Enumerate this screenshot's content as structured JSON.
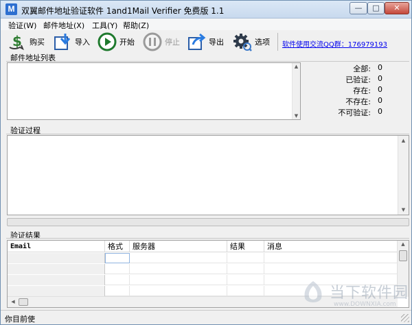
{
  "window": {
    "title": "双翼邮件地址验证软件 1and1Mail Verifier 免费版  1.1",
    "app_icon_letter": "M",
    "buttons": {
      "minimize": "—",
      "maximize": "□",
      "close": "✕"
    }
  },
  "menu": [
    {
      "label": "验证(W)"
    },
    {
      "label": "邮件地址(X)"
    },
    {
      "label": "工具(Y)"
    },
    {
      "label": "帮助(Z)"
    }
  ],
  "toolbar": {
    "buttons": [
      {
        "label": "购买",
        "icon": "dollar-icon",
        "enabled": true
      },
      {
        "label": "导入",
        "icon": "import-icon",
        "enabled": true
      },
      {
        "label": "开始",
        "icon": "play-icon",
        "enabled": true
      },
      {
        "label": "停止",
        "icon": "pause-icon",
        "enabled": false
      },
      {
        "label": "导出",
        "icon": "export-icon",
        "enabled": true
      },
      {
        "label": "选项",
        "icon": "gear-icon",
        "enabled": true
      }
    ],
    "qq_link": "软件使用交流QQ群：176979193"
  },
  "email_list": {
    "title": "邮件地址列表",
    "stats": [
      {
        "label": "全部:",
        "value": "0"
      },
      {
        "label": "已验证:",
        "value": "0"
      },
      {
        "label": "存在:",
        "value": "0"
      },
      {
        "label": "不存在:",
        "value": "0"
      },
      {
        "label": "不可验证:",
        "value": "0"
      }
    ]
  },
  "process": {
    "title": "验证过程",
    "progress": 0
  },
  "results": {
    "title": "验证结果",
    "columns": [
      "Email",
      "格式",
      "服务器",
      "结果",
      "消息"
    ]
  },
  "status": {
    "text": "你目前使"
  },
  "watermark": {
    "cn": "当下软件园",
    "en": "www.DOWNXIA.com"
  },
  "colors": {
    "accent": "#2d6fd0",
    "link": "#0000ee",
    "progress": "#3cb043"
  }
}
